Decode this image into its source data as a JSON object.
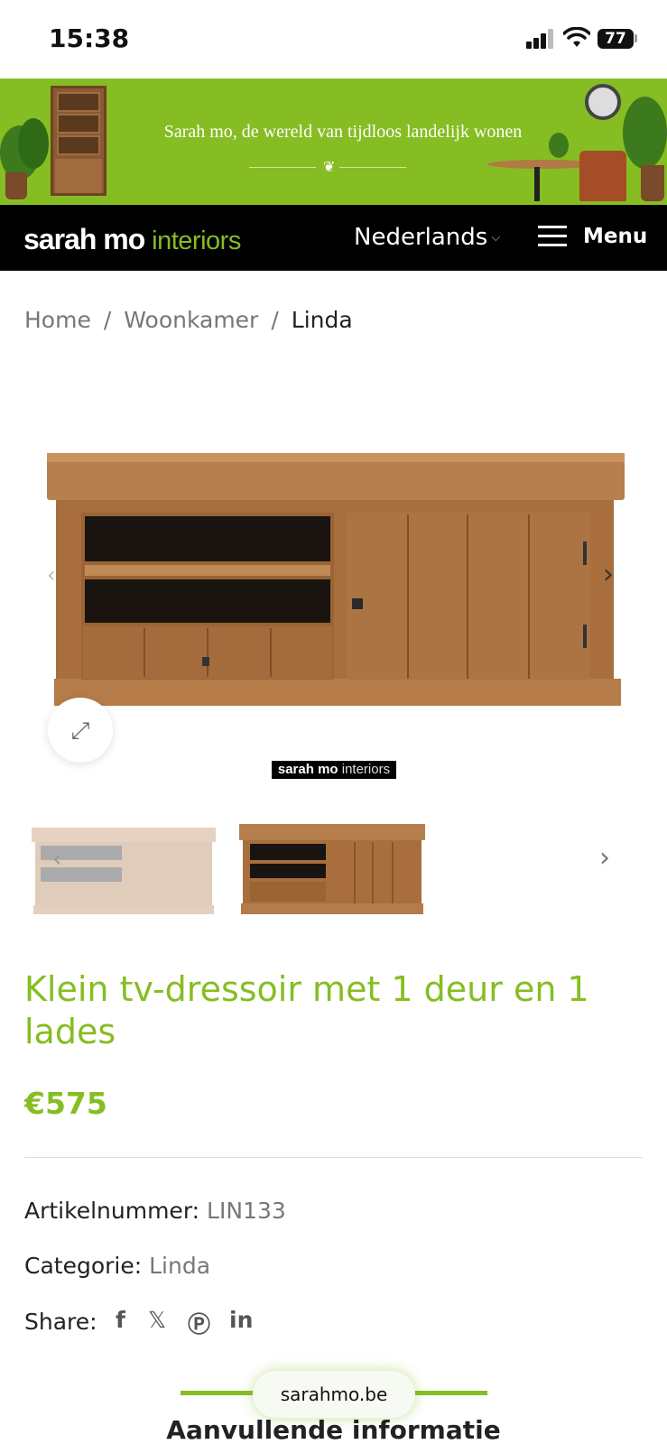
{
  "status_bar": {
    "time": "15:38",
    "battery": "77"
  },
  "banner": {
    "tagline": "Sarah mo, de wereld van tijdloos landelijk wonen"
  },
  "header": {
    "logo_brand": "sarah mo",
    "logo_sub": "interiors",
    "language": "Nederlands",
    "menu_label": "Menu"
  },
  "breadcrumb": [
    "Home",
    "Woonkamer",
    "Linda"
  ],
  "gallery": {
    "watermark_brand": "sarah mo",
    "watermark_sub": "interiors"
  },
  "product": {
    "title": "Klein tv-dressoir met 1 deur en 1 lades",
    "price": "€575",
    "sku_label": "Artikelnummer:",
    "sku_value": "LIN133",
    "category_label": "Categorie:",
    "category_value": "Linda",
    "share_label": "Share:"
  },
  "share_icons": [
    "facebook-icon",
    "x-icon",
    "pinterest-icon",
    "linkedin-icon"
  ],
  "footer": {
    "url": "sarahmo.be",
    "section_title": "Aanvullende informatie"
  },
  "colors": {
    "brand_green": "#86bd22",
    "nav_bg": "#000000"
  }
}
